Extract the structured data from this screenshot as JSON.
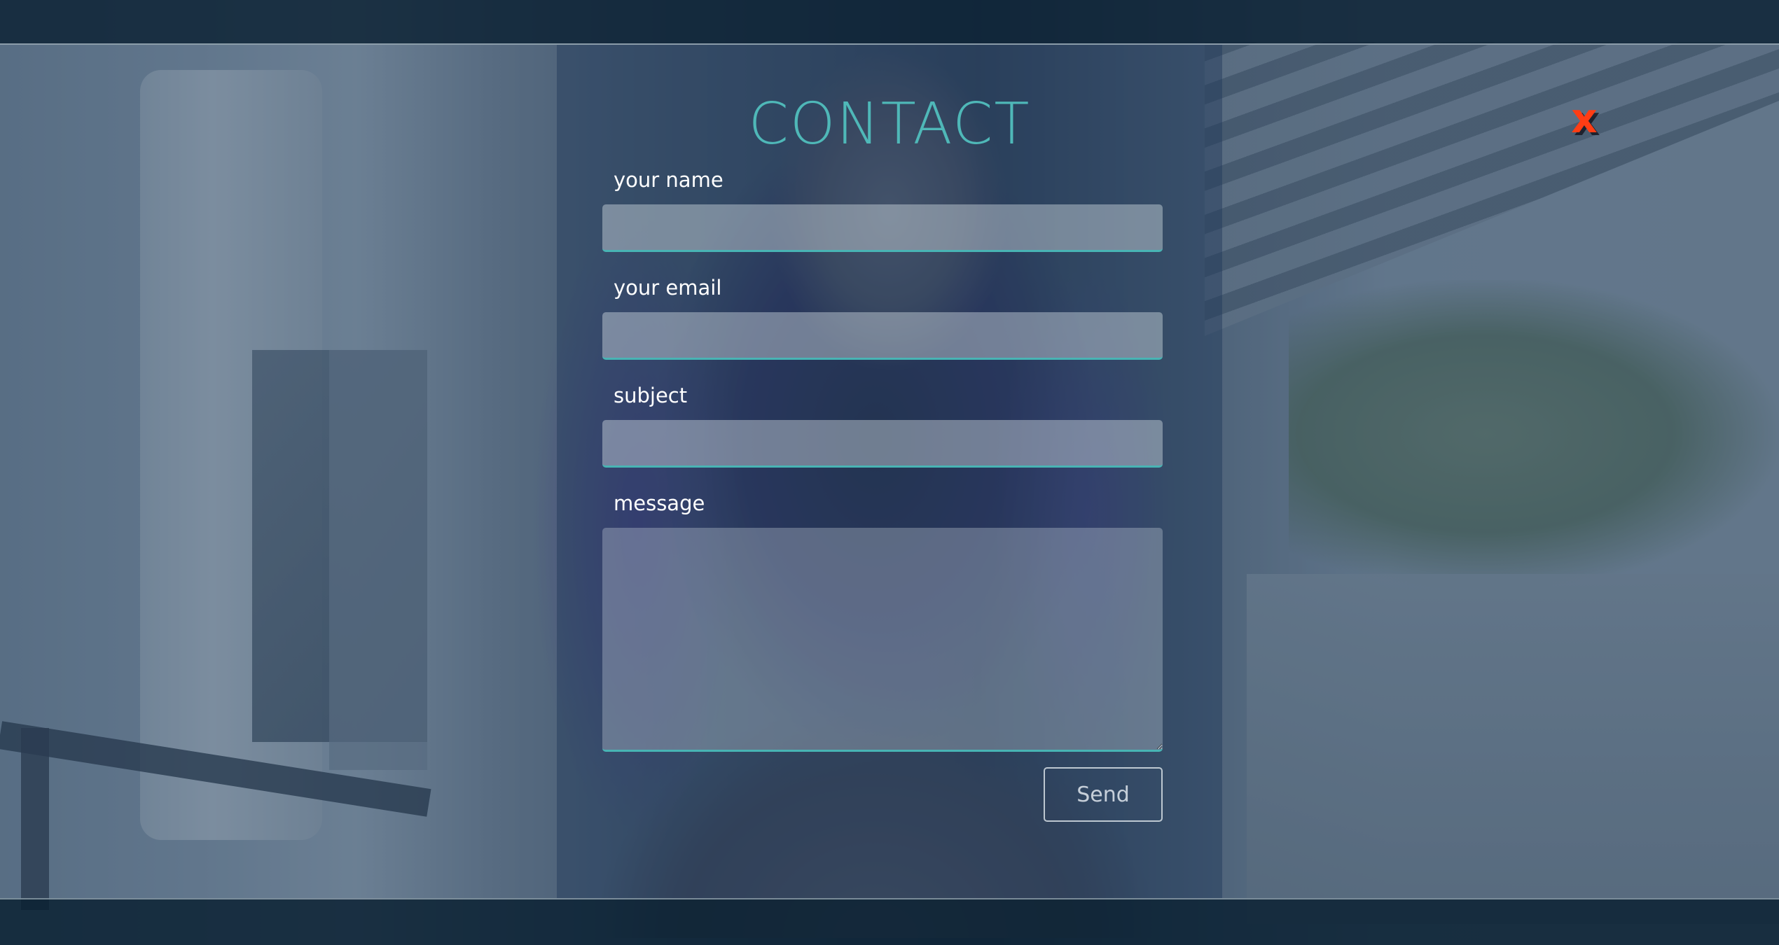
{
  "modal": {
    "title": "CONTACT",
    "close_label": "x"
  },
  "form": {
    "name_label": "your name",
    "name_value": "",
    "email_label": "your email",
    "email_value": "",
    "subject_label": "subject",
    "subject_value": "",
    "message_label": "message",
    "message_value": "",
    "send_label": "Send"
  },
  "colors": {
    "accent": "#4fb8b8",
    "close": "#ff3d14",
    "overlay": "#203858"
  },
  "icons": {
    "close": "close-icon"
  }
}
